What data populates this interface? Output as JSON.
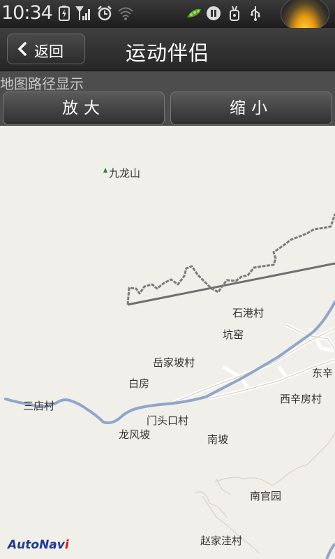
{
  "status_bar": {
    "time": "10:34",
    "icons": [
      "battery-charging-icon",
      "signal-icon",
      "alarm-icon",
      "wifi-icon",
      "pea-icon",
      "pause-icon",
      "usb-debug-icon",
      "usb-icon",
      "sun-icon"
    ]
  },
  "header": {
    "back_label": "返回",
    "title": "运动伴侣"
  },
  "toolbar": {
    "section_label": "地图路径显示",
    "zoom_in_label": "放大",
    "zoom_out_label": "缩小"
  },
  "map": {
    "places": {
      "jiulongshan": "九龙山",
      "shigangcun": "石港村",
      "kengyao": "坑窑",
      "yuejiapocun": "岳家坡村",
      "baifang": "白房",
      "dongxin": "东辛",
      "xixinfangcun": "西辛房村",
      "sandiancun": "三店村",
      "mentoukoucun": "门头口村",
      "longfengpo": "龙风坡",
      "nanpo": "南坡",
      "nanguanyuan": "南官园",
      "zhaojiawacun": "赵家洼村"
    },
    "logo_main": "AutoNav",
    "logo_i": "i",
    "colors": {
      "background": "#f1efe9",
      "river": "#8fa7c9",
      "road": "#ffffff",
      "track": "#6f6f6f"
    }
  }
}
